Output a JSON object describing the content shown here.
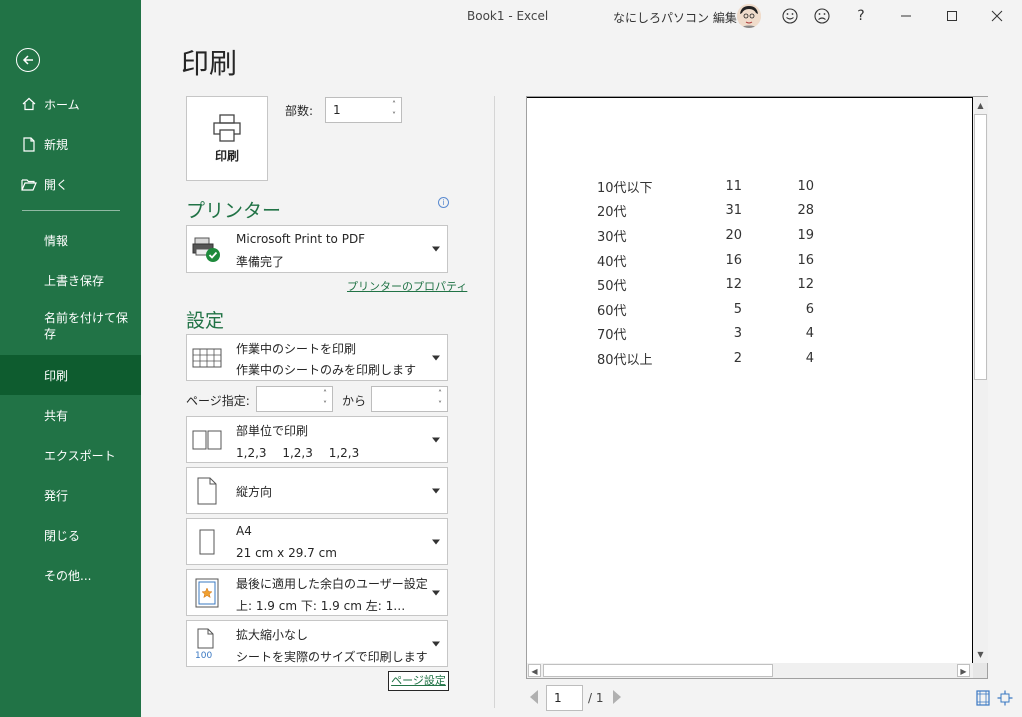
{
  "window": {
    "title": "Book1  -  Excel",
    "user_name": "なにしろパソコン 編集長",
    "help": "?"
  },
  "sidebar": {
    "items": [
      {
        "label": "ホーム",
        "icon": "home-icon"
      },
      {
        "label": "新規",
        "icon": "new-document-icon"
      },
      {
        "label": "開く",
        "icon": "open-folder-icon"
      },
      {
        "label": "情報"
      },
      {
        "label": "上書き保存"
      },
      {
        "label": "名前を付けて保存"
      },
      {
        "label": "印刷",
        "active": true
      },
      {
        "label": "共有"
      },
      {
        "label": "エクスポート"
      },
      {
        "label": "発行"
      },
      {
        "label": "閉じる"
      },
      {
        "label": "その他..."
      }
    ]
  },
  "page_title": "印刷",
  "print_button_label": "印刷",
  "copies": {
    "label": "部数:",
    "value": "1"
  },
  "printer": {
    "heading": "プリンター",
    "name": "Microsoft Print to PDF",
    "status": "準備完了",
    "properties_link": "プリンターのプロパティ"
  },
  "settings": {
    "heading": "設定",
    "scope": {
      "line1": "作業中のシートを印刷",
      "line2": "作業中のシートのみを印刷します"
    },
    "pages": {
      "label": "ページ指定:",
      "to_label": "から",
      "from_value": "",
      "to_value": ""
    },
    "collation": {
      "line1": "部単位で印刷",
      "line2": "1,2,3　 1,2,3　 1,2,3"
    },
    "orientation": {
      "line1": "縦方向"
    },
    "paper": {
      "line1": "A4",
      "line2": "21 cm x 29.7 cm"
    },
    "margins": {
      "line1": "最後に適用した余白のユーザー設定",
      "line2": "上: 1.9 cm 下: 1.9 cm 左: 1…"
    },
    "scaling": {
      "line1": "拡大縮小なし",
      "line2": "シートを実際のサイズで印刷します"
    },
    "page_setup_link": "ページ設定"
  },
  "preview": {
    "rows": [
      [
        "10代以下",
        "11",
        "10"
      ],
      [
        "20代",
        "31",
        "28"
      ],
      [
        "30代",
        "20",
        "19"
      ],
      [
        "40代",
        "16",
        "16"
      ],
      [
        "50代",
        "12",
        "12"
      ],
      [
        "60代",
        "5",
        "6"
      ],
      [
        "70代",
        "3",
        "4"
      ],
      [
        "80代以上",
        "2",
        "4"
      ]
    ],
    "current_page": "1",
    "total_pages": "/ 1"
  },
  "colors": {
    "accent": "#217346",
    "active_nav": "#0e5c2f"
  }
}
